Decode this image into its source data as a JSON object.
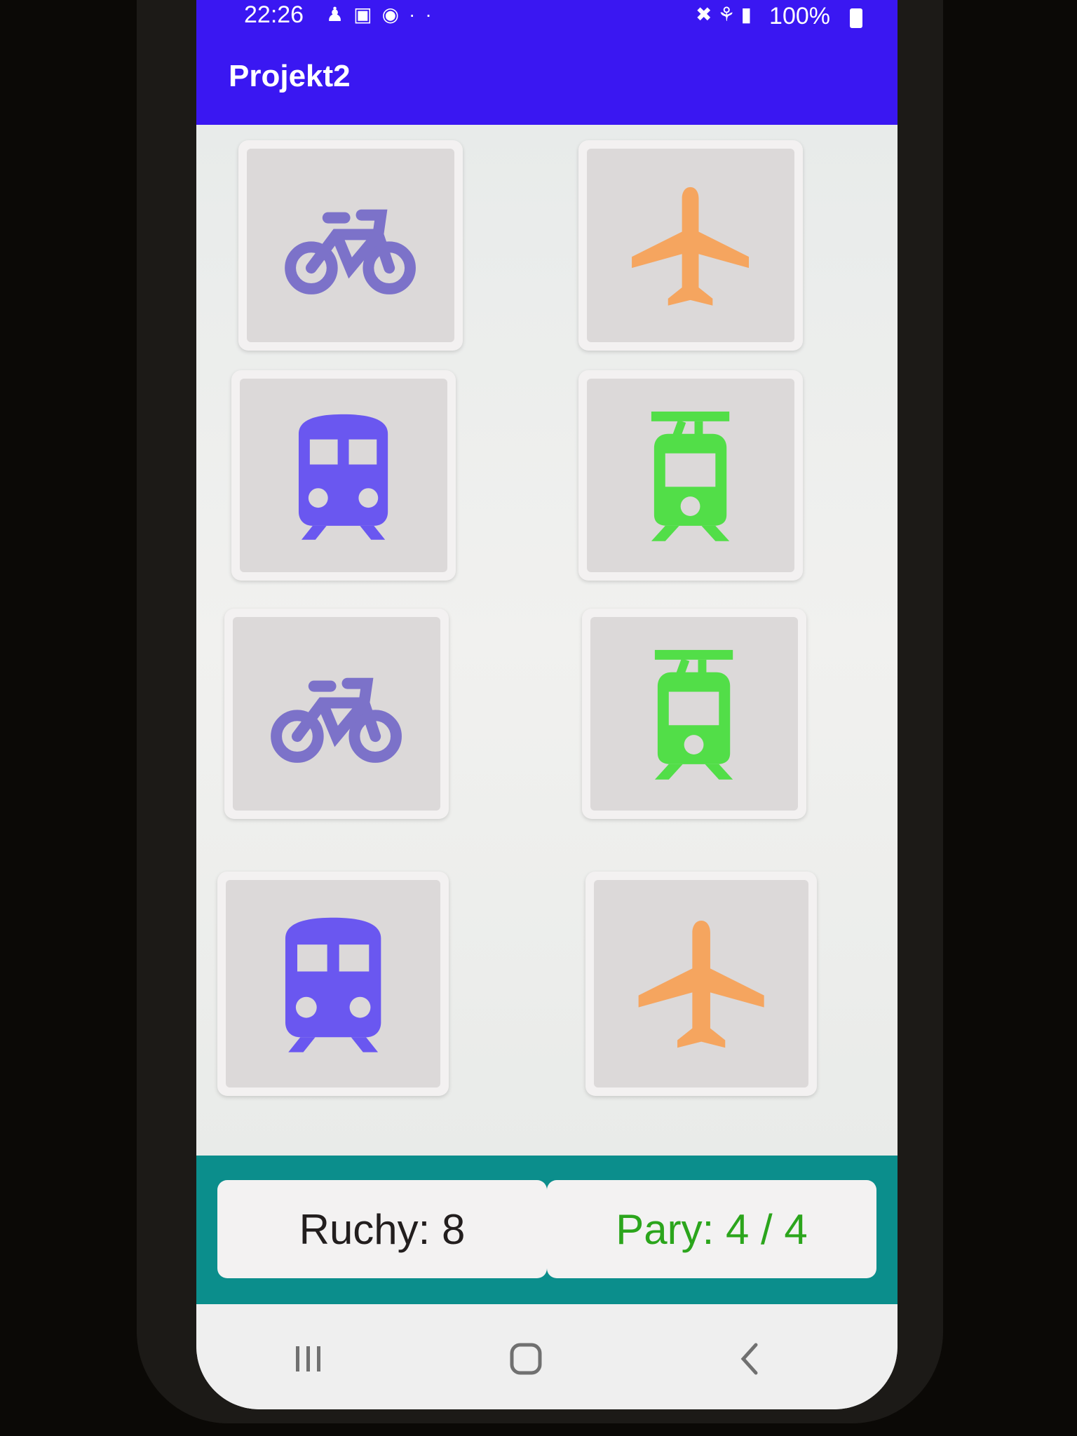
{
  "status_bar": {
    "time": "22:26",
    "battery": "100%",
    "left_icons": [
      "person-icon",
      "bag-icon",
      "facebook-icon",
      "more-dots-icon"
    ],
    "right_icons": [
      "mute-icon",
      "wifi-icon",
      "signal-icon",
      "battery-icon"
    ]
  },
  "app_bar": {
    "title": "Projekt2"
  },
  "cards": [
    {
      "icon": "bicycle-icon",
      "color": "#7c72c9"
    },
    {
      "icon": "airplane-icon",
      "color": "#f5a55f"
    },
    {
      "icon": "train-icon",
      "color": "#6a57f0"
    },
    {
      "icon": "tram-icon",
      "color": "#52de48"
    },
    {
      "icon": "bicycle-icon",
      "color": "#7c72c9"
    },
    {
      "icon": "tram-icon",
      "color": "#52de48"
    },
    {
      "icon": "train-icon",
      "color": "#6a57f0"
    },
    {
      "icon": "airplane-icon",
      "color": "#f5a55f"
    }
  ],
  "score": {
    "moves_text": "Ruchy: 8",
    "pairs_text": "Pary: 4 / 4"
  },
  "nav": {
    "recent_icon": "recent-apps-icon",
    "home_icon": "home-icon",
    "back_icon": "back-icon"
  },
  "colors": {
    "app_bar": "#3a17f2",
    "bottom_panel": "#0b8e8c",
    "pairs_text": "#2ba51c"
  }
}
